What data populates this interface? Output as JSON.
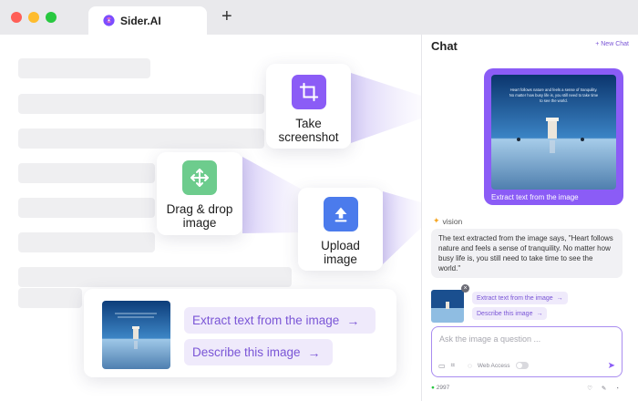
{
  "browser": {
    "tab_title": "Sider.AI",
    "new_tab_icon": "plus-icon",
    "window_controls": [
      "#ff5f57",
      "#febc2e",
      "#28c840"
    ]
  },
  "features": {
    "screenshot": {
      "label": "Take\nscreenshot",
      "icon": "crop-icon",
      "color": "#8b5cf6"
    },
    "dragdrop": {
      "label": "Drag & drop\nimage",
      "icon": "move-arrows-icon",
      "color": "#6dcc8d"
    },
    "upload": {
      "label": "Upload\nimage",
      "icon": "upload-icon",
      "color": "#4b7bec"
    }
  },
  "floatbar": {
    "extract_label": "Extract text from the image",
    "describe_label": "Describe this image"
  },
  "chat": {
    "title": "Chat",
    "new_chat": "+ New Chat",
    "image_quote": "Heart follows nature and feels a sense of tranquility. No matter how busy life is, you still need to take time to see the world.",
    "user_caption": "Extract text from the image",
    "model_name": "vision",
    "answer": "The text extracted from the image says, \"Heart follows nature and feels a sense of tranquility. No matter how busy life is, you still need to take time to see the world.\"",
    "chip_extract": "Extract text from the image",
    "chip_describe": "Describe this image",
    "input_placeholder": "Ask the image a question ...",
    "web_access": "Web Access",
    "footer_count": "2997"
  },
  "accent_color": "#8b5cf6"
}
